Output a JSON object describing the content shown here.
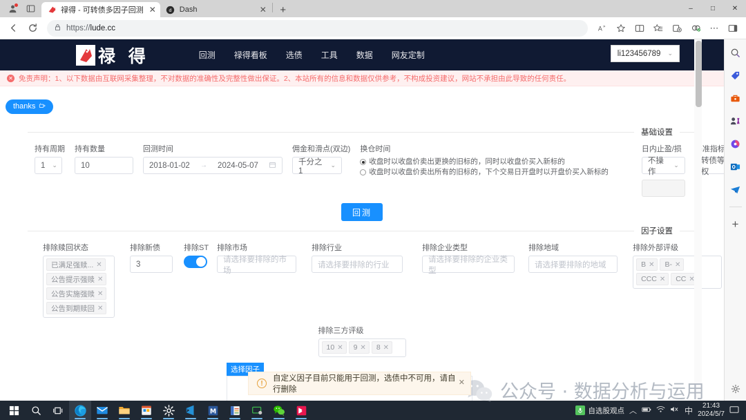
{
  "browser": {
    "tabs": [
      {
        "title": "禄得 - 可转债多因子回测",
        "favicon": "lude-icon",
        "active": true
      },
      {
        "title": "Dash",
        "favicon": "dash-icon",
        "active": false
      }
    ],
    "new_tab_label": "+",
    "url_prefix": "https://",
    "url_domain": "lude.cc",
    "window_controls": {
      "minimize": "–",
      "maximize": "□",
      "close": "✕"
    },
    "toolbar_icons": [
      "read-aloud-icon",
      "favorite-star-icon",
      "split-screen-icon",
      "favorites-bar-icon",
      "collections-icon",
      "browser-essentials-icon",
      "settings-more-icon",
      "sidebar-toggle-icon"
    ]
  },
  "sidebar": {
    "items": [
      "search-icon",
      "shopping-tag-icon",
      "tools-icon",
      "contacts-icon",
      "copilot-icon",
      "outlook-icon",
      "telegram-icon"
    ],
    "add_label": "+"
  },
  "site": {
    "logo_text": "禄 得",
    "nav": [
      "回测",
      "禄得看板",
      "选债",
      "工具",
      "数据",
      "网友定制"
    ],
    "user": "li123456789",
    "disclaimer": "免责声明：1、以下数据由互联网采集整理，不对数据的准确性及完整性做出保证。2、本站所有的信息和数据仅供参考，不构成投资建议，网站不承担由此导致的任何责任。",
    "thanks_label": "thanks"
  },
  "basic_settings": {
    "title": "基础设置",
    "hold_period": {
      "label": "持有周期",
      "value": "1"
    },
    "hold_count": {
      "label": "持有数量",
      "value": "10"
    },
    "backtest_time": {
      "label": "回测时间",
      "start": "2018-01-02",
      "end": "2024-05-07",
      "separator": "→"
    },
    "commission": {
      "label": "佣金和滑点(双边)",
      "value": "千分之1"
    },
    "rebalance": {
      "label": "换仓时间",
      "options": [
        {
          "text": "收盘时以收盘价卖出更换的旧标的，同时以收盘价买入新标的",
          "selected": true
        },
        {
          "text": "收盘时以收盘价卖出所有的旧标的，下个交易日开盘时以开盘价买入新标的",
          "selected": false
        }
      ]
    },
    "intraday_stop": {
      "label": "日内止盈/损",
      "value": "不操作",
      "extra_value": ""
    },
    "benchmark": {
      "label": "基准指标",
      "value": "转债等权"
    },
    "submit_label": "回测"
  },
  "factor_settings": {
    "title": "因子设置",
    "exclude_redemption": {
      "label": "排除赎回状态",
      "tags": [
        "已满足强赎...",
        "公告提示强赎",
        "公告实施强赎",
        "公告到期赎回"
      ]
    },
    "exclude_new_bond": {
      "label": "排除新债",
      "value": "3"
    },
    "exclude_st": {
      "label": "排除ST",
      "on": true
    },
    "exclude_market": {
      "label": "排除市场",
      "placeholder": "请选择要排除的市场"
    },
    "exclude_industry": {
      "label": "排除行业",
      "placeholder": "请选择要排除的行业"
    },
    "exclude_company_type": {
      "label": "排除企业类型",
      "placeholder": "请选择要排除的企业类型"
    },
    "exclude_region": {
      "label": "排除地域",
      "placeholder": "请选择要排除的地域"
    },
    "exclude_external_rating": {
      "label": "排除外部评级",
      "tags": [
        "B",
        "B-",
        "CCC",
        "CC"
      ]
    },
    "exclude_third_rating": {
      "label": "排除三方评级",
      "tags": [
        "10",
        "9",
        "8"
      ]
    },
    "select_factor_label": "选择因子"
  },
  "alert": {
    "text": "自定义因子目前只能用于回测，选债中不可用，请自行删除",
    "close": "✕",
    "icon": "warning-icon"
  },
  "watermark": {
    "text": "公众号 · 数据分析与运用",
    "icon": "wechat-icon"
  },
  "taskbar": {
    "items": [
      "start-icon",
      "search-icon",
      "task-view-icon",
      "edge-icon",
      "mail-icon",
      "file-explorer-icon",
      "store-icon",
      "settings-icon",
      "vscode-icon",
      "word-icon",
      "pdf-icon",
      "remote-desktop-icon",
      "wechat-icon",
      "app-icon"
    ],
    "tray_app": "自选股观点",
    "tray_icons": [
      "chevron-up-icon",
      "battery-icon",
      "wifi-icon",
      "volume-mute-icon",
      "ime-chinese-icon"
    ],
    "time": "21:43",
    "date": "2024/5/7",
    "notification": "notification-icon"
  },
  "colors": {
    "accent": "#1890ff",
    "header_bg": "#101a33",
    "warn_bg": "#fdf6ec",
    "danger": "#f56c6c"
  }
}
